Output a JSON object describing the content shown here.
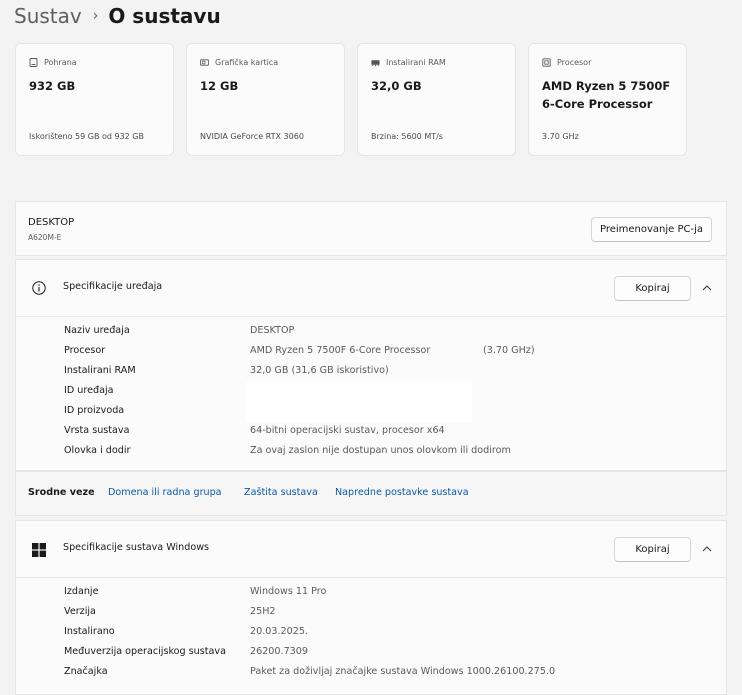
{
  "breadcrumb": {
    "root": "Sustav",
    "separator": "›",
    "current": "O sustavu"
  },
  "cards": [
    {
      "icon": "storage-icon",
      "label": "Pohrana",
      "value": "932 GB",
      "sub": "Iskorišteno 59 GB od 932 GB"
    },
    {
      "icon": "graphics-card-icon",
      "label": "Grafička kartica",
      "value": "12 GB",
      "sub": "NVIDIA GeForce RTX 3060"
    },
    {
      "icon": "ram-icon",
      "label": "Instalirani RAM",
      "value": "32,0 GB",
      "sub": "Brzina: 5600 MT/s"
    },
    {
      "icon": "processor-icon",
      "label": "Procesor",
      "value": "AMD Ryzen 5 7500F 6-Core Processor",
      "sub": "3.70 GHz"
    }
  ],
  "device": {
    "name": "DESKTOP",
    "model": "A620M-E",
    "rename_button": "Preimenovanje PC-ja"
  },
  "device_specs": {
    "title": "Specifikacije uređaja",
    "copy_button": "Kopiraj",
    "rows": [
      {
        "label": "Naziv uređaja",
        "value": "DESKTOP"
      },
      {
        "label": "Procesor",
        "value": "AMD Ryzen 5 7500F 6-Core Processor",
        "extra": "(3.70 GHz)"
      },
      {
        "label": "Instalirani RAM",
        "value": "32,0 GB (31,6 GB iskoristivo)"
      },
      {
        "label": "ID uređaja",
        "value": ""
      },
      {
        "label": "ID proizvoda",
        "value": ""
      },
      {
        "label": "Vrsta sustava",
        "value": "64-bitni operacijski sustav, procesor x64"
      },
      {
        "label": "Olovka i dodir",
        "value": "Za ovaj zaslon nije dostupan unos olovkom ili dodirom"
      }
    ]
  },
  "related": {
    "label": "Srodne veze",
    "links": [
      "Domena ili radna grupa",
      "Zaštita sustava",
      "Napredne postavke sustava"
    ]
  },
  "windows_specs": {
    "title": "Specifikacije sustava Windows",
    "copy_button": "Kopiraj",
    "rows": [
      {
        "label": "Izdanje",
        "value": "Windows 11 Pro"
      },
      {
        "label": "Verzija",
        "value": "25H2"
      },
      {
        "label": "Instalirano",
        "value": "20.03.2025."
      },
      {
        "label": "Međuverzija operacijskog sustava",
        "value": "26200.7309"
      },
      {
        "label": "Značajka",
        "value": "Paket za doživljaj značajke sustava Windows 1000.26100.275.0"
      }
    ]
  }
}
